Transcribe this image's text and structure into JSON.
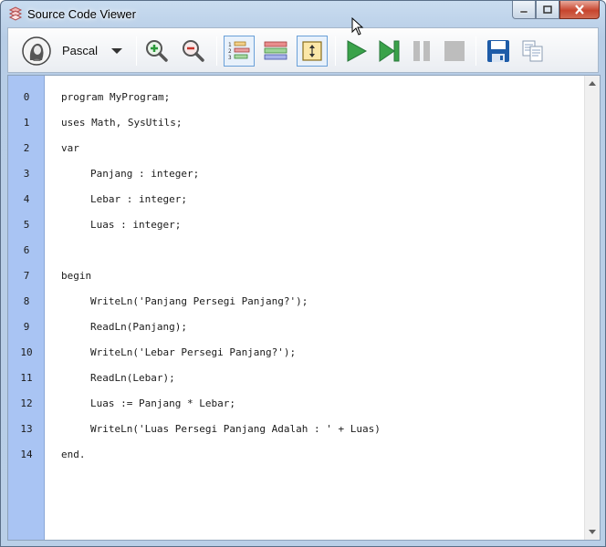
{
  "window": {
    "title": "Source Code Viewer"
  },
  "toolbar": {
    "language": "Pascal",
    "buttons": [
      "language-picker",
      "zoom-in",
      "zoom-out",
      "toggle-line-numbers",
      "toggle-highlight",
      "fit-to-window",
      "run",
      "step",
      "pause",
      "stop",
      "save",
      "copy"
    ]
  },
  "editor": {
    "lines": [
      {
        "no": "0",
        "text": "program MyProgram;",
        "indent": false
      },
      {
        "no": "1",
        "text": "uses Math, SysUtils;",
        "indent": false
      },
      {
        "no": "2",
        "text": "var",
        "indent": false
      },
      {
        "no": "3",
        "text": "Panjang : integer;",
        "indent": true
      },
      {
        "no": "4",
        "text": "Lebar : integer;",
        "indent": true
      },
      {
        "no": "5",
        "text": "Luas : integer;",
        "indent": true
      },
      {
        "no": "6",
        "text": "",
        "indent": false
      },
      {
        "no": "7",
        "text": "begin",
        "indent": false
      },
      {
        "no": "8",
        "text": "WriteLn('Panjang Persegi Panjang?');",
        "indent": true
      },
      {
        "no": "9",
        "text": "ReadLn(Panjang);",
        "indent": true
      },
      {
        "no": "10",
        "text": "WriteLn('Lebar Persegi Panjang?');",
        "indent": true
      },
      {
        "no": "11",
        "text": "ReadLn(Lebar);",
        "indent": true
      },
      {
        "no": "12",
        "text": "Luas := Panjang * Lebar;",
        "indent": true
      },
      {
        "no": "13",
        "text": "WriteLn('Luas Persegi Panjang Adalah : ' + Luas)",
        "indent": true
      },
      {
        "no": "14",
        "text": "end.",
        "indent": false
      }
    ]
  },
  "colors": {
    "gutter": "#a9c4f3",
    "run_green": "#3aa24a",
    "save_blue": "#1e5ca8",
    "title_bg": "#c9dcf0"
  }
}
